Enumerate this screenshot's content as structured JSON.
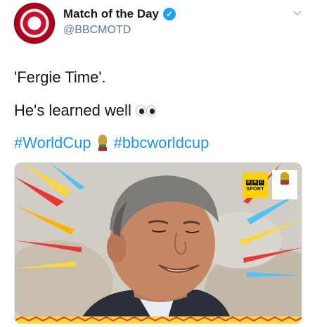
{
  "tweet": {
    "display_name": "Match of the Day",
    "handle": "@BBCMOTD",
    "line1": "'Fergie Time'.",
    "line2": "He's learned well",
    "hashtags": [
      "#WorldCup",
      "#bbcworldcup"
    ]
  },
  "media": {
    "badge_bbc": "BBC",
    "badge_sport": "SPORT"
  },
  "icons": {
    "avatar": "match-of-the-day-logo",
    "verified": "verified-badge-icon",
    "caret": "chevron-down-icon",
    "emoji": "eyes-icon",
    "hashflag": "world-cup-trophy-icon"
  },
  "colors": {
    "link": "#1b95e0",
    "verified": "#1da1f2",
    "bbc_yellow": "#ffd200"
  }
}
